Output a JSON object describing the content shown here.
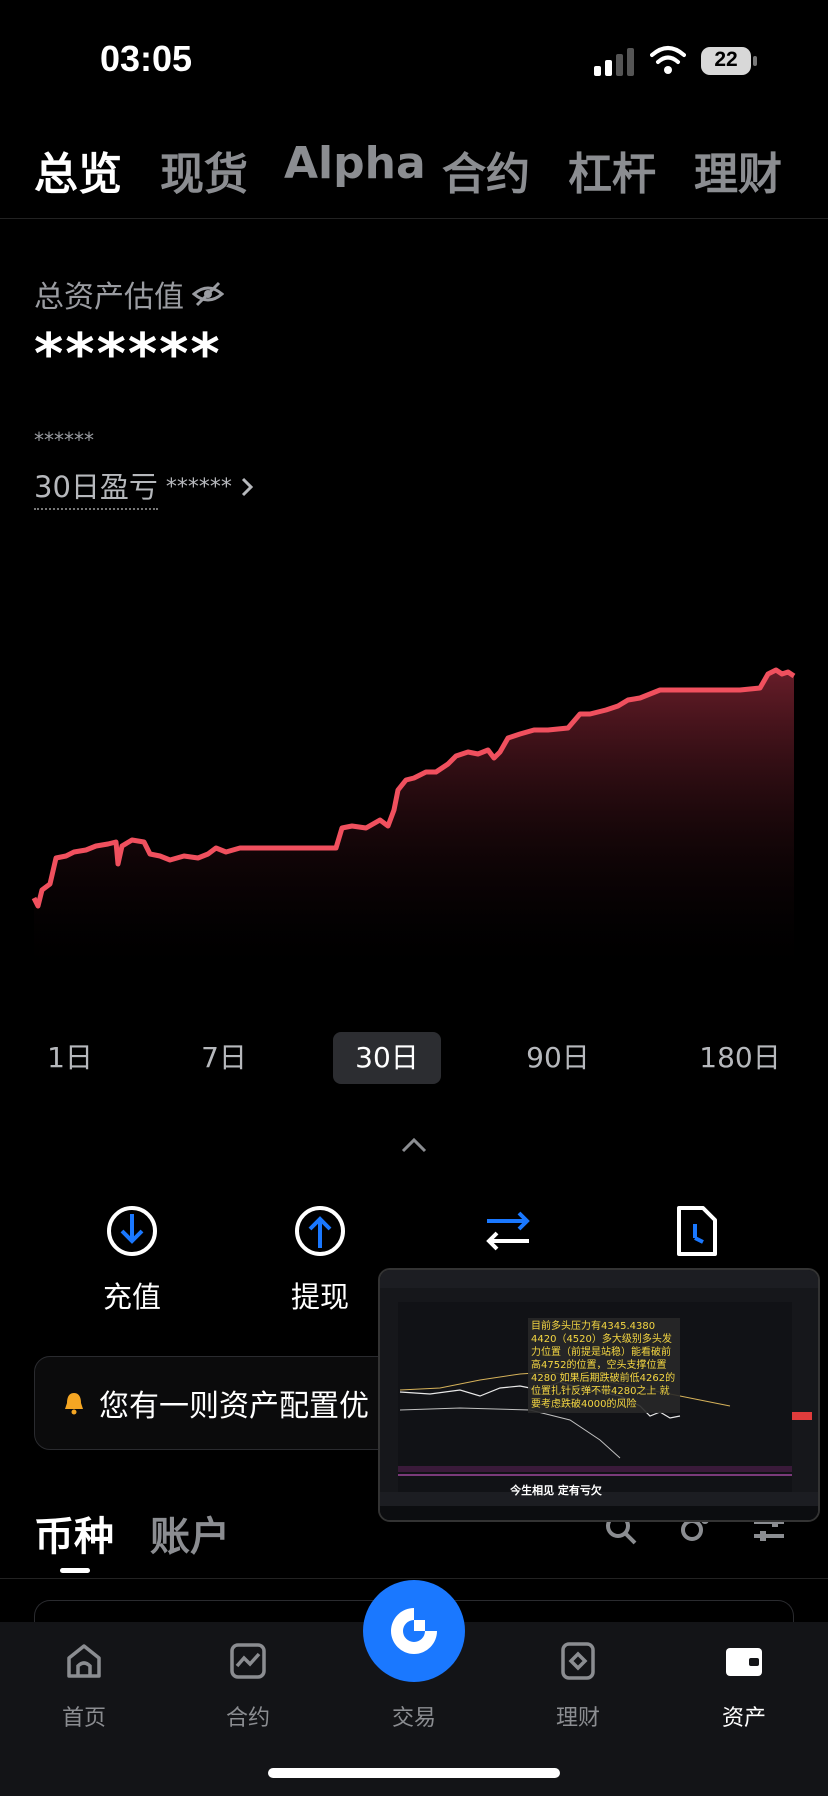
{
  "status_bar": {
    "time": "03:05",
    "battery": "22"
  },
  "top_tabs": [
    "总览",
    "现货",
    "Alpha",
    "合约",
    "杠杆",
    "理财"
  ],
  "summary": {
    "label": "总资产估值",
    "value": "******",
    "small_value": "******",
    "pnl_label": "30日盈亏",
    "pnl_value": "******"
  },
  "chart_data": {
    "type": "area",
    "color": "#f0505e",
    "trend": "upward (values hidden)"
  },
  "ranges": [
    "1日",
    "7日",
    "30日",
    "90日",
    "180日"
  ],
  "selected_range": "30日",
  "actions": [
    {
      "label": "充值",
      "icon": "deposit-icon"
    },
    {
      "label": "提现",
      "icon": "withdraw-icon"
    },
    {
      "label": "",
      "icon": "transfer-icon"
    },
    {
      "label": "",
      "icon": "history-icon"
    }
  ],
  "notice": {
    "text": "您有一则资产配置优"
  },
  "sub_tabs": [
    "币种",
    "账户"
  ],
  "float_video": {
    "overlay_text": "目前多头压力有4345.4380 4420（4520）多大级别多头发力位置（前提是站稳）能看破前高4752的位置，空头支撑位置4280 如果后期跌破前低4262的位置扎针反弹不带4280之上 就要考虑跌破4000的风险",
    "caption": "今生相见 定有亏欠"
  },
  "bottom_nav": [
    "首页",
    "合约",
    "交易",
    "理财",
    "资产"
  ],
  "colors": {
    "accent": "#1a78ff",
    "chart": "#f0505e",
    "background": "#000000"
  }
}
